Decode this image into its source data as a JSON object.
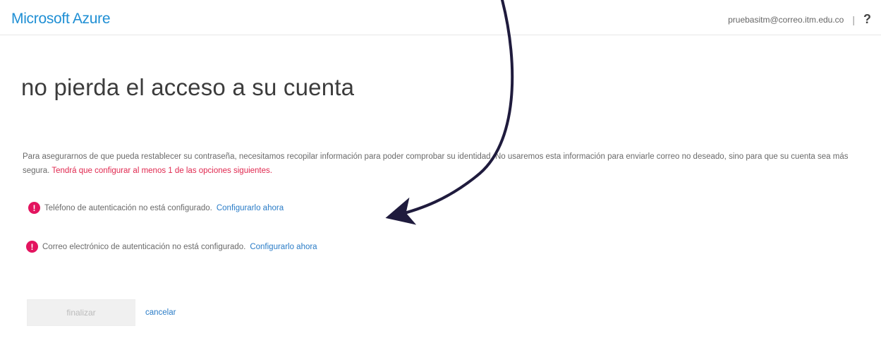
{
  "header": {
    "brand": "Microsoft Azure",
    "user_email": "pruebasitm@correo.itm.edu.co",
    "separator": "|",
    "help": "?"
  },
  "main": {
    "title": "no pierda el acceso a su cuenta",
    "description": "Para asegurarnos de que pueda restablecer su contraseña, necesitamos recopilar información para poder comprobar su identidad. No usaremos esta información para enviarle correo no deseado, sino para que su cuenta sea más segura.",
    "warning": "Tendrá que configurar al menos 1 de las opciones siguientes.",
    "items": [
      {
        "text": "Teléfono de autenticación no está configurado.",
        "link": "Configurarlo ahora"
      },
      {
        "text": "Correo electrónico de autenticación no está configurado.",
        "link": "Configurarlo ahora"
      }
    ]
  },
  "actions": {
    "finish_label": "finalizar",
    "cancel_label": "cancelar"
  },
  "colors": {
    "brand": "#1f8fd4",
    "warning": "#e0284f",
    "alert_icon": "#e3145f",
    "link": "#2a7cc7",
    "annotation_arrow": "#1f1b3d"
  },
  "icons": {
    "alert": "alert-circle-icon",
    "help": "help-question-icon"
  }
}
